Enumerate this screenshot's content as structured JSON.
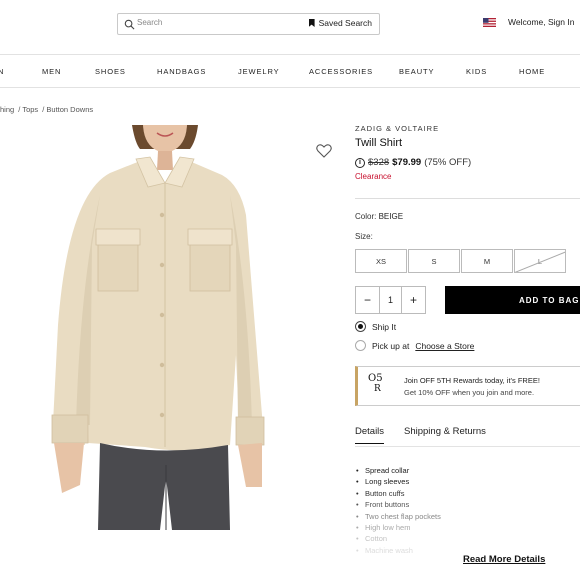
{
  "header": {
    "search_placeholder": "Search",
    "saved_search": "Saved Search",
    "welcome": "Welcome, Sign In"
  },
  "nav": {
    "items": [
      "N",
      "MEN",
      "SHOES",
      "HANDBAGS",
      "JEWELRY",
      "ACCESSORIES",
      "BEAUTY",
      "KIDS",
      "HOME"
    ]
  },
  "breadcrumb": [
    "hing",
    "/ Tops",
    "/ Button Downs"
  ],
  "product": {
    "brand": "ZADIG & VOLTAIRE",
    "title": "Twill Shirt",
    "info_icon": "i",
    "old_price": "$328",
    "new_price": "$79.99",
    "discount": "(75% OFF)",
    "clearance": "Clearance",
    "color_label": "Color:",
    "color_value": "BEIGE",
    "size_label": "Size:",
    "sizes": [
      "XS",
      "S",
      "M",
      "L"
    ],
    "quantity": "1",
    "add_to_bag": "ADD TO BAG",
    "ship_it": "Ship It",
    "pickup_prefix": "Pick up at",
    "pickup_link": "Choose a Store",
    "colors": {
      "clearance": "#c8102e",
      "button": "#000000",
      "rewards_accent": "#c8a464"
    }
  },
  "rewards": {
    "logo_top": "O5",
    "logo_bottom": "R",
    "line1": "Join OFF 5TH Rewards today, it's FREE!",
    "line2": "Get 10% OFF when you join and more."
  },
  "tabs": {
    "details": "Details",
    "shipping": "Shipping & Returns"
  },
  "details": [
    "Spread collar",
    "Long sleeves",
    "Button cuffs",
    "Front buttons",
    "Two chest flap pockets",
    "High low hem",
    "Cotton",
    "Machine wash"
  ],
  "read_more": "Read More Details"
}
